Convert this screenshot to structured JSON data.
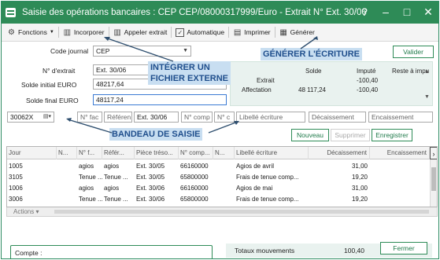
{
  "window": {
    "title": "Saisie des opérations bancaires : CEP CEP/08000317999/Euro - Extrait N° Ext. 30/06",
    "controls": [
      "?",
      "–",
      "□",
      "✕"
    ]
  },
  "toolbar": {
    "fonctions": "Fonctions",
    "incorporer": "Incorporer",
    "appeler_extrait": "Appeler extrait",
    "automatique": "Automatique",
    "imprimer": "Imprimer",
    "generer": "Générer"
  },
  "journal": {
    "label": "Code journal",
    "value": "CEP",
    "valider": "Valider"
  },
  "extrait": {
    "num_label": "N° d'extrait",
    "num_value": "Ext. 30/06",
    "solde_initial_label": "Solde initial EURO",
    "solde_initial_value": "48217,64",
    "solde_final_label": "Solde final EURO",
    "solde_final_value": "48117,24"
  },
  "summary": {
    "headers": {
      "solde": "Solde",
      "impute": "Imputé",
      "reste": "Reste à impu"
    },
    "rows": [
      {
        "label": "Extrait",
        "solde": "",
        "impute": "-100,40"
      },
      {
        "label": "Affectation",
        "solde": "48 117,24",
        "impute": "-100,40"
      }
    ]
  },
  "entry": {
    "code": "30062X",
    "fields": [
      "N° fac",
      "Référen",
      "Ext. 30/06",
      "N° comp",
      "N° c",
      "Libellé écriture",
      "Décaissement",
      "Encaissement"
    ],
    "buttons": {
      "nouveau": "Nouveau",
      "supprimer": "Supprimer",
      "enregistrer": "Enregistrer"
    }
  },
  "callouts": {
    "integrer": "INTÉGRER UN\nFICHIER EXTERNE",
    "generer": "GÉNÉRER L'ÉCRITURE",
    "bandeau": "BANDEAU DE SAISIE"
  },
  "grid": {
    "headers": [
      "Jour",
      "N...",
      "N° f...",
      "Référ...",
      "Pièce tréso...",
      "N° comp...",
      "N...",
      "Libellé écriture",
      "Décaissement",
      "Encaissement"
    ],
    "rows": [
      {
        "jour": "1005",
        "nfac": "agios",
        "ref": "agios",
        "piece": "Ext. 30/05",
        "compte": "66160000",
        "libelle": "Agios de avril",
        "decaissement": "31,00",
        "encaissement": ""
      },
      {
        "jour": "3105",
        "nfac": "Tenue ...",
        "ref": "Tenue ...",
        "piece": "Ext. 30/05",
        "compte": "65800000",
        "libelle": "Frais de tenue comp...",
        "decaissement": "19,20",
        "encaissement": ""
      },
      {
        "jour": "1006",
        "nfac": "agios",
        "ref": "agios",
        "piece": "Ext. 30/06",
        "compte": "66160000",
        "libelle": "Agios de mai",
        "decaissement": "31,00",
        "encaissement": ""
      },
      {
        "jour": "3006",
        "nfac": "Tenue ...",
        "ref": "Tenue ...",
        "piece": "Ext. 30/06",
        "compte": "65800000",
        "libelle": "Frais de tenue comp...",
        "decaissement": "19,20",
        "encaissement": ""
      }
    ],
    "actions": "Actions"
  },
  "footer": {
    "compte_label": "Compte :",
    "totaux_label": "Totaux mouvements",
    "totaux_value": "100,40",
    "fermer": "Fermer"
  },
  "colors": {
    "accent": "#2e8b57",
    "callout_bg": "#c8def1",
    "callout_text": "#1f4e8c",
    "panel_bg": "#e9f2ef"
  }
}
